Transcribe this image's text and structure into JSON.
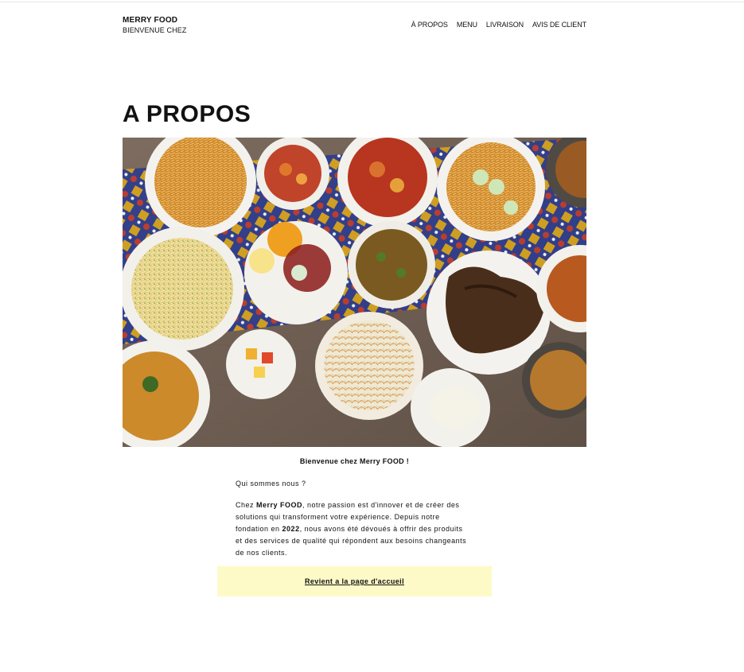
{
  "header": {
    "brand_name": "MERRY FOOD",
    "brand_tagline": "BIENVENUE CHEZ",
    "nav": [
      {
        "label": "À PROPOS"
      },
      {
        "label": "MENU"
      },
      {
        "label": "LIVRAISON"
      },
      {
        "label": "AVIS DE CLIENT"
      }
    ]
  },
  "main": {
    "title": "A PROPOS",
    "hero_image": "food-spread-photo",
    "welcome": "Bienvenue chez Merry FOOD !",
    "question": "Qui sommes nous ?",
    "paragraph": {
      "p1": "Chez ",
      "brand": "Merry FOOD",
      "p2": ", notre passion est d'innover et de créer des solutions qui transforment votre expérience. Depuis notre fondation en ",
      "year": "2022",
      "p3": ", nous avons été dévoués à offrir des produits et des services de qualité qui répondent aux besoins changeants de nos clients."
    },
    "cta_label": "Revient a la page d'accueil"
  },
  "colors": {
    "cta_background": "#fdfac7",
    "text": "#111111"
  }
}
